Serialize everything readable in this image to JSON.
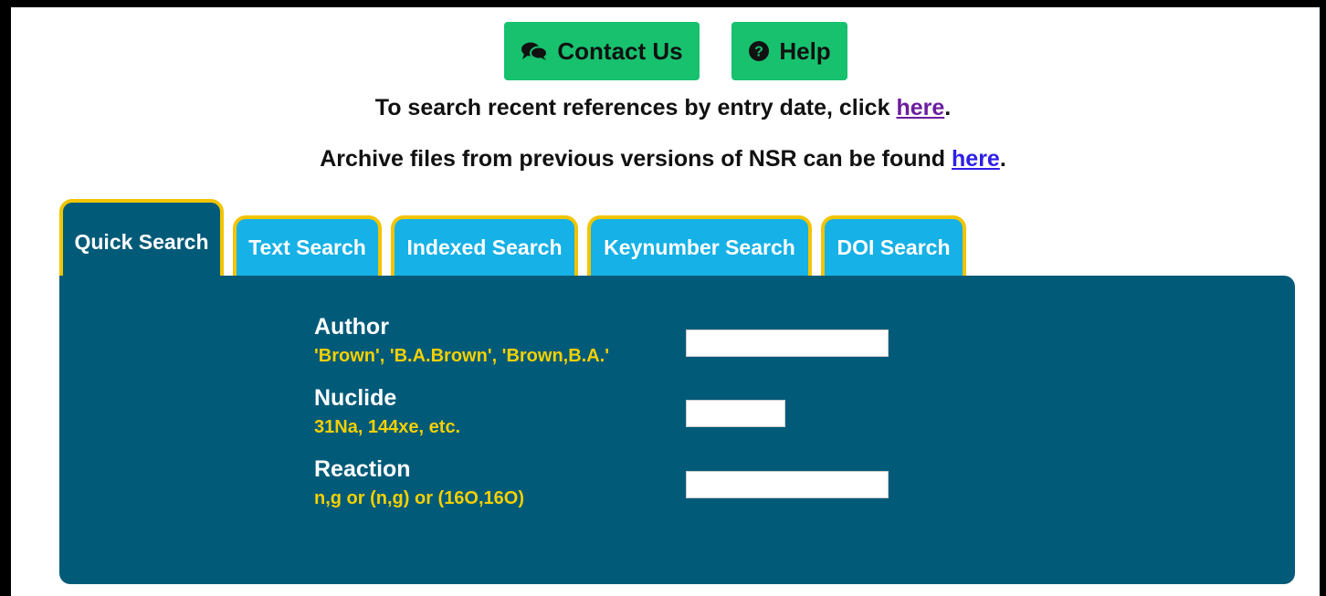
{
  "header": {
    "contact_label": "Contact Us",
    "contact_icon": "comments-icon",
    "help_label": "Help",
    "help_icon": "question-circle-icon",
    "button_color": "#18c16e"
  },
  "notices": {
    "recent_prefix": "To search recent references by entry date, click ",
    "recent_link": "here",
    "recent_suffix": ".",
    "archive_prefix": "Archive files from previous versions of NSR can be found ",
    "archive_link": "here",
    "archive_suffix": "."
  },
  "tabs": [
    {
      "label": "Quick Search",
      "active": true
    },
    {
      "label": "Text Search",
      "active": false
    },
    {
      "label": "Indexed Search",
      "active": false
    },
    {
      "label": "Keynumber Search",
      "active": false
    },
    {
      "label": "DOI Search",
      "active": false
    }
  ],
  "form": {
    "author": {
      "label": "Author",
      "hint": "'Brown', 'B.A.Brown', 'Brown,B.A.'",
      "value": ""
    },
    "nuclide": {
      "label": "Nuclide",
      "hint": "31Na, 144xe, etc.",
      "value": ""
    },
    "reaction": {
      "label": "Reaction",
      "hint": "n,g or (n,g) or (16O,16O)",
      "value": ""
    }
  },
  "colors": {
    "panel": "#005a78",
    "tab_inactive": "#16b1e6",
    "tab_border": "#f2c400",
    "hint_text": "#f5d000"
  }
}
